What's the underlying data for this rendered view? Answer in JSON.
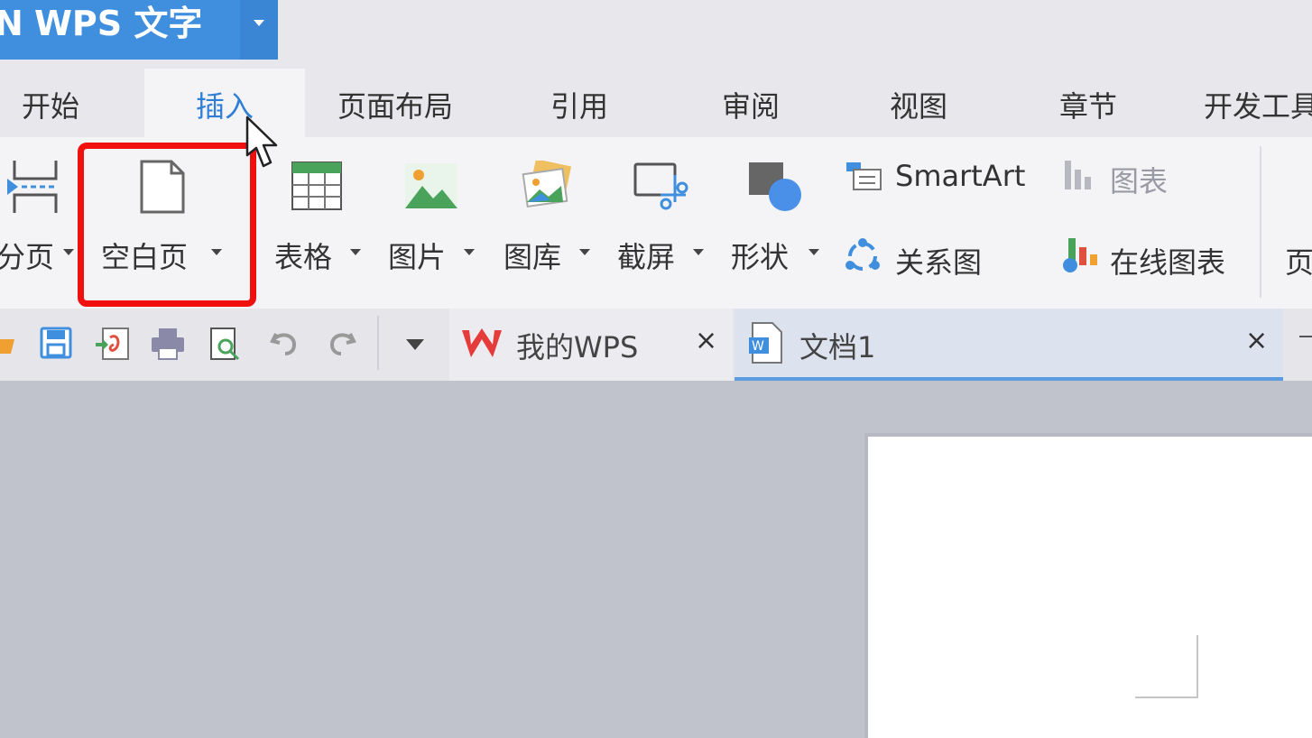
{
  "app": {
    "title": "WPS 文字",
    "dropdown_icon": "caret-down-icon"
  },
  "menu_tabs": [
    {
      "label": "开始"
    },
    {
      "label": "插入"
    },
    {
      "label": "页面布局"
    },
    {
      "label": "引用"
    },
    {
      "label": "审阅"
    },
    {
      "label": "视图"
    },
    {
      "label": "章节"
    },
    {
      "label": "开发工具"
    }
  ],
  "active_menu_tab": "插入",
  "ribbon": {
    "page_break": "分页",
    "blank_page": "空白页",
    "table": "表格",
    "picture": "图片",
    "gallery": "图库",
    "screenshot": "截屏",
    "shapes": "形状",
    "smartart": "SmartArt",
    "chart": "图表",
    "relation_chart": "关系图",
    "online_chart": "在线图表",
    "partial_next": "页"
  },
  "quick_access": {
    "icons": [
      "open-icon",
      "save-icon",
      "export-pdf-icon",
      "print-icon",
      "print-preview-icon",
      "undo-icon",
      "redo-icon",
      "customize-dropdown-icon"
    ]
  },
  "doc_tabs": [
    {
      "label": "我的WPS",
      "icon": "wps-logo-icon",
      "close": "×"
    },
    {
      "label": "文档1",
      "icon": "word-doc-icon",
      "close": "×"
    }
  ],
  "colors": {
    "accent": "#3f8fde",
    "active_tab_text": "#2f7fd6",
    "highlight_box": "#f01010",
    "wps_red": "#e63b3b",
    "canvas_bg": "#c0c3cb"
  }
}
